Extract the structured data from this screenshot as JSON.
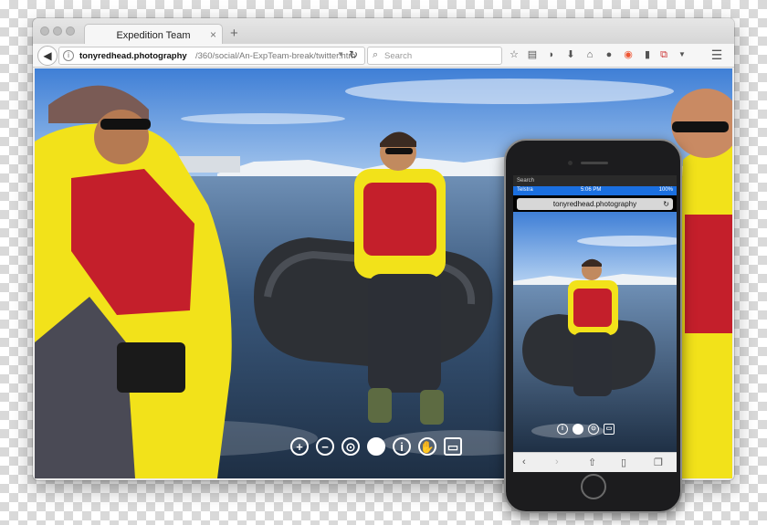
{
  "browser": {
    "tab_title": "Expedition Team",
    "tab_close": "×",
    "new_tab": "+",
    "url_host": "tonyredhead.photography",
    "url_path": "/360/social/An-ExpTeam-break/twitter.htm",
    "search_placeholder": "Search"
  },
  "viewer_controls": [
    "zoom-in",
    "zoom-out",
    "vr",
    "autoplay",
    "info",
    "hand-drag",
    "fullscreen"
  ],
  "phone": {
    "carrier": "Telstra",
    "time": "5:06 PM",
    "battery": "100%",
    "back_label": "Search",
    "url": "tonyredhead.photography"
  },
  "colors": {
    "sky": "#4a8ad8",
    "water": "#2e4d72",
    "jacket": "#f2e21a",
    "lifevest": "#c41f2b",
    "ios_status": "#1a6fe0"
  }
}
